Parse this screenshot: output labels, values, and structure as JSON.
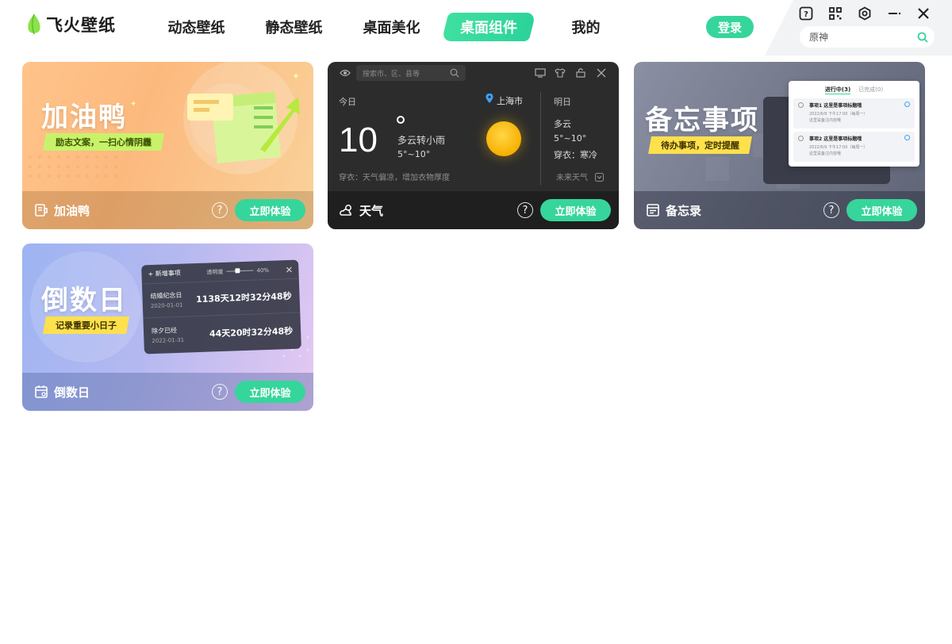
{
  "app": {
    "name": "飞火壁纸"
  },
  "nav": {
    "items": [
      {
        "label": "动态壁纸"
      },
      {
        "label": "静态壁纸"
      },
      {
        "label": "桌面美化"
      },
      {
        "label": "桌面组件",
        "active": true
      },
      {
        "label": "我的"
      }
    ]
  },
  "header": {
    "login_label": "登录",
    "search_value": "原神"
  },
  "colors": {
    "accent": "#36d59b",
    "nav_active": "#2bd39a"
  },
  "cards": [
    {
      "title": "加油鸭",
      "banner_title": "加油鸭",
      "banner_tag": "励志文案，一扫心情阴霾",
      "button": "立即体验",
      "icon": "duck-widget-icon"
    },
    {
      "title": "天气",
      "button": "立即体验",
      "icon": "cloud-sun-icon",
      "widget": {
        "search_placeholder": "搜索市、区、县等",
        "today_label": "今日",
        "location": "上海市",
        "temperature": "10",
        "condition": "多云转小雨",
        "range": "5°~10°",
        "dress_tip": "穿衣：天气偏凉，增加衣物厚度",
        "tomorrow_label": "明日",
        "tomorrow_condition": "多云",
        "tomorrow_range": "5°~10°",
        "tomorrow_dress": "穿衣：寒冷",
        "future_label": "未来天气"
      }
    },
    {
      "title": "备忘录",
      "banner_title": "备忘事项",
      "banner_tag": "待办事项，定时提醒",
      "button": "立即体验",
      "icon": "memo-icon",
      "widget": {
        "tab_active": "进行中(3)",
        "tab_done": "已完成(0)",
        "items": [
          {
            "title": "事项1 这里是事项标题哦",
            "time": "2022/6/9 下午17:00（每周一）",
            "note": "这里是备注内容哦"
          },
          {
            "title": "事项2 这里是事项标题哦",
            "time": "2022/6/9 下午17:00（每周一）",
            "note": "这里是备注内容哦"
          }
        ]
      }
    },
    {
      "title": "倒数日",
      "banner_title": "倒数日",
      "banner_tag": "记录重要小日子",
      "button": "立即体验",
      "icon": "calendar-icon",
      "widget": {
        "add_label": "+ 新增事项",
        "opacity_label": "透明度",
        "opacity_value": "40%",
        "opacity_fraction": 0.4,
        "events": [
          {
            "name": "结婚纪念日",
            "date": "2020-01-01",
            "elapsed": "1138天12时32分48秒"
          },
          {
            "name": "除夕已经",
            "date": "2022-01-31",
            "elapsed": "44天20时32分48秒"
          }
        ]
      }
    }
  ]
}
